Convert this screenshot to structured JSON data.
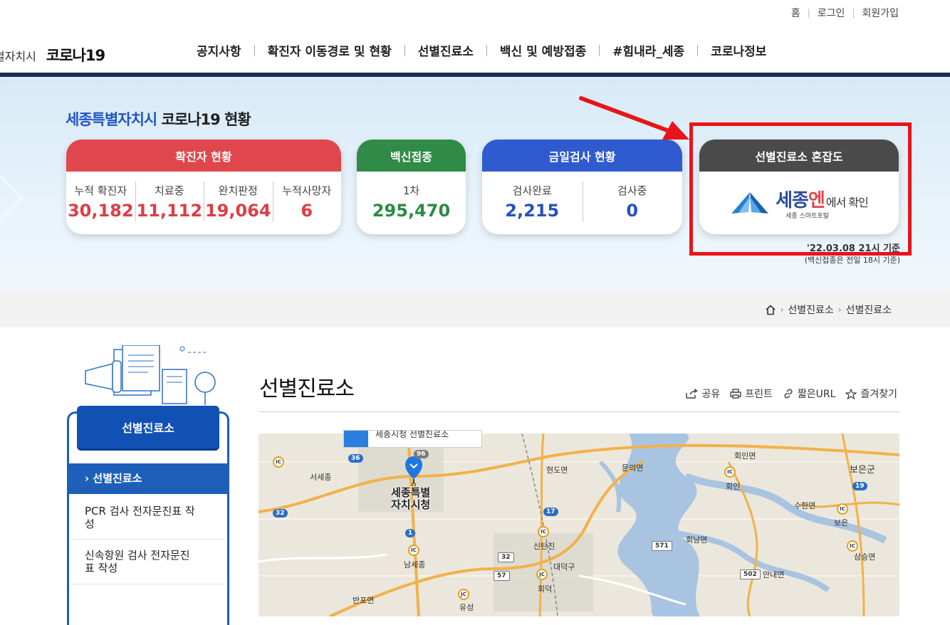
{
  "header": {
    "util_links": [
      "홈",
      "로그인",
      "회원가입"
    ],
    "city": "별자치시",
    "brand": "코로나19",
    "nav": [
      "공지사항",
      "확진자 이동경로 및 현황",
      "선별진료소",
      "백신 및 예방접종",
      "#힘내라_세종",
      "코로나정보"
    ]
  },
  "hero": {
    "title_city": "세종특별자치시",
    "title_rest": "코로나19 현황",
    "confirmed": {
      "title": "확진자 현황",
      "items": [
        {
          "label": "누적 확진자",
          "value": "30,182"
        },
        {
          "label": "치료중",
          "value": "11,112"
        },
        {
          "label": "완치판정",
          "value": "19,064"
        },
        {
          "label": "누적사망자",
          "value": "6"
        }
      ]
    },
    "vaccine": {
      "title": "백신접종",
      "items": [
        {
          "label": "1차",
          "value": "295,470"
        }
      ]
    },
    "test": {
      "title": "금일검사 현황",
      "items": [
        {
          "label": "검사완료",
          "value": "2,215"
        },
        {
          "label": "검사중",
          "value": "0"
        }
      ]
    },
    "congestion": {
      "title": "선별진료소 혼잡도",
      "logo_main": "세종",
      "logo_red": "엔",
      "logo_suffix": "에서 확인",
      "logo_sub": "세종 스마트포털"
    },
    "note_date": "'22.03.08 21시 기준",
    "note_vaccine": "(백신접종은 전일 18시 기준)"
  },
  "breadcrumb": [
    "선별진료소",
    "선별진료소"
  ],
  "sidebar": {
    "title": "선별진료소",
    "items": [
      "선별진료소",
      "PCR 검사 전자문진표 작성",
      "신속항원 검사 전자문진표 작성"
    ]
  },
  "content": {
    "title": "선별진료소",
    "tools": [
      "공유",
      "프린트",
      "짧은URL",
      "즐겨찾기"
    ]
  },
  "map": {
    "popup": "세종시청 선별진료소",
    "center_label": "세종특별\n자치시청",
    "labels": [
      "서세종",
      "현도면",
      "문의면",
      "회인면",
      "보은군",
      "회인",
      "수한면",
      "보은",
      "회남면",
      "신탄진",
      "대덕구",
      "남세종",
      "삼승면",
      "안내면",
      "회덕",
      "반포면",
      "유성"
    ],
    "road_numbers": [
      "96",
      "36",
      "32",
      "17",
      "1",
      "32",
      "571",
      "57",
      "502",
      "19"
    ]
  },
  "colors": {
    "confirmed": "#e0474c",
    "vaccine": "#2f8b45",
    "test": "#2f5bcf",
    "congestion": "#4a4a4a",
    "highlight": "#e8141b",
    "sidebar": "#1e5fb9"
  }
}
